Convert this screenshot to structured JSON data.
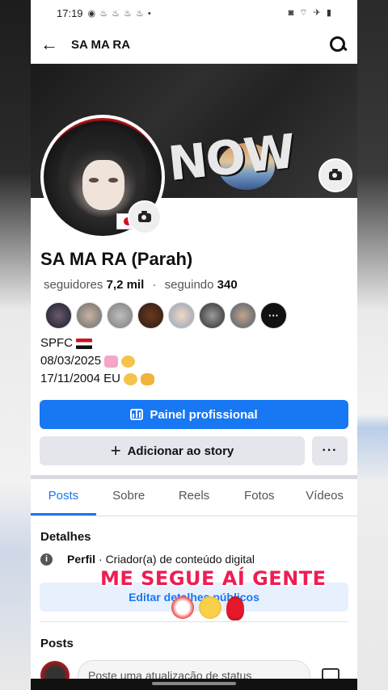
{
  "status_bar": {
    "time": "17:19",
    "notif_icons": "◉ ♨ ♨ ♨ ♨ •",
    "right_icons": "◙ ⌔ ✈ ▮"
  },
  "header": {
    "back_icon": "arrow-left-icon",
    "title": "SA MA RA",
    "search_icon": "search-icon"
  },
  "profile": {
    "name": "SA MA RA (Parah)",
    "followers_label": "seguidores",
    "followers_count": "7,2 mil",
    "separator": "·",
    "following_label": "seguindo",
    "following_count": "340",
    "bio": {
      "line1": "SPFC",
      "line2": "08/03/2025",
      "line3": "17/11/2004 EU"
    },
    "friends_more": "···"
  },
  "actions": {
    "primary": "Painel profissional",
    "secondary_plus": "+",
    "secondary": "Adicionar ao story",
    "more": "···"
  },
  "tabs": [
    "Posts",
    "Sobre",
    "Reels",
    "Fotos",
    "Vídeos"
  ],
  "details": {
    "title": "Detalhes",
    "info_icon": "i",
    "perfil_label": "Perfil",
    "perfil_value": "· Criador(a) de conteúdo digital",
    "edit_button": "Editar detalhes públicos"
  },
  "overlay": {
    "text": "ME SEGUE AÍ GENTE"
  },
  "posts": {
    "title": "Posts",
    "compose_placeholder": "Poste uma atualização de status"
  },
  "colors": {
    "brand": "#1877f2",
    "overlay_text": "#ee1d52"
  }
}
